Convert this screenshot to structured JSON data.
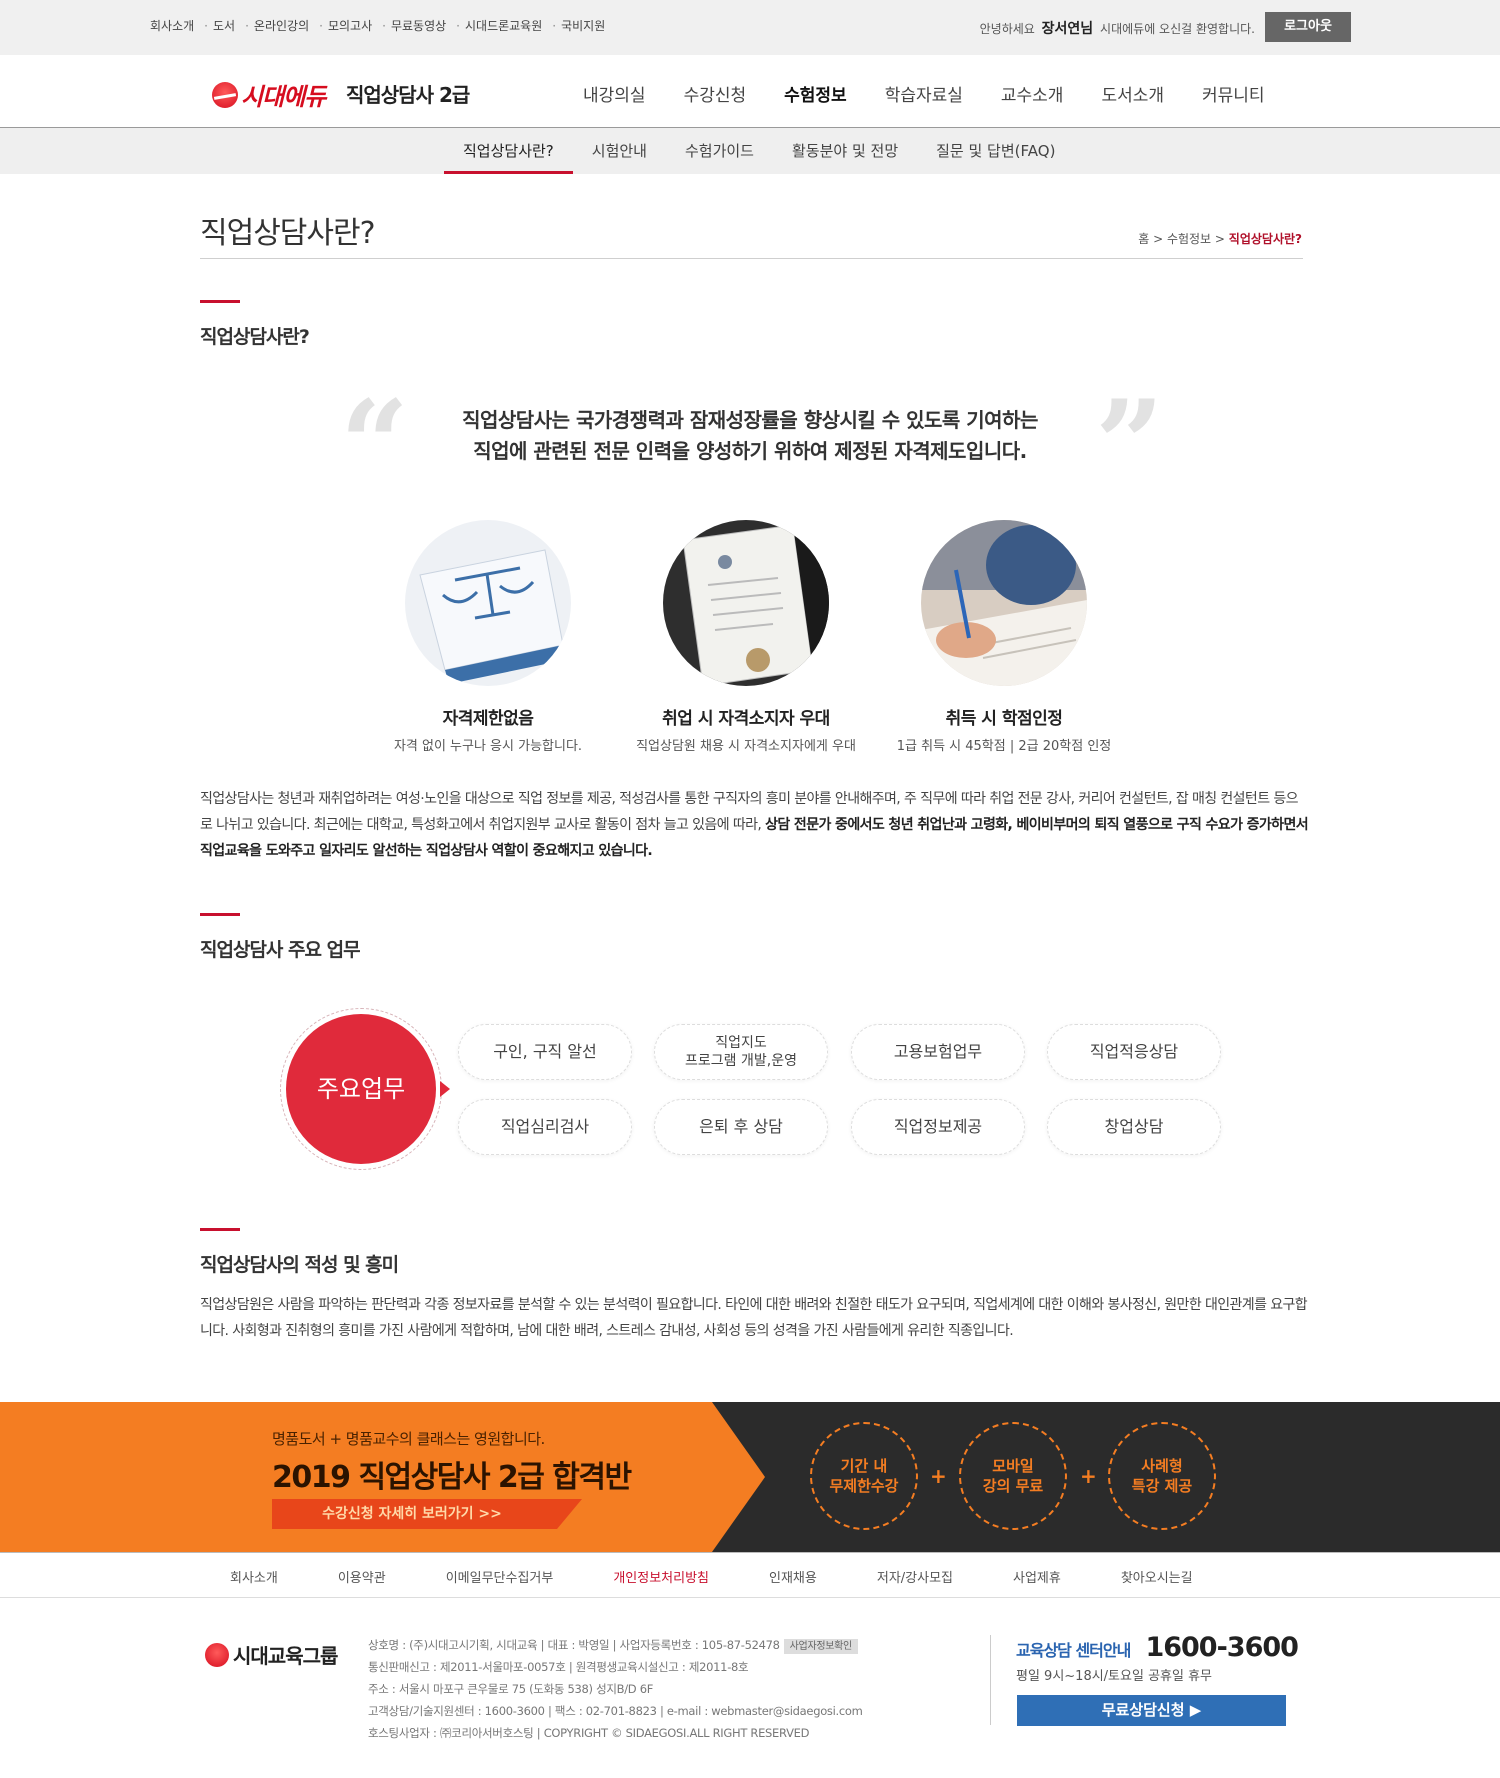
{
  "topbar": {
    "links": [
      "회사소개",
      "도서",
      "온라인강의",
      "모의고사",
      "무료동영상",
      "시대드론교육원",
      "국비지원"
    ],
    "greeting_pre": "안녕하세요",
    "user_name": "장서연님",
    "greeting_post": "시대에듀에 오신걸 환영합니다.",
    "logout_label": "로그아웃"
  },
  "header": {
    "logo_text": "시대에듀",
    "site_title": "직업상담사 2급",
    "gnb": [
      "내강의실",
      "수강신청",
      "수험정보",
      "학습자료실",
      "교수소개",
      "도서소개",
      "커뮤니티"
    ],
    "gnb_active": "수험정보"
  },
  "subnav": {
    "items": [
      "직업상담사란?",
      "시험안내",
      "수험가이드",
      "활동분야 및 전망",
      "질문 및 답변(FAQ)"
    ],
    "active": "직업상담사란?"
  },
  "page": {
    "title": "직업상담사란?",
    "breadcrumb": [
      "홈",
      "수험정보",
      "직업상담사란?"
    ]
  },
  "section1": {
    "title": "직업상담사란?",
    "quote_line1": "직업상담사는 국가경쟁력과 잠재성장률을 향상시킬 수 있도록 기여하는",
    "quote_line2": "직업에 관련된 전문 인력을 양성하기 위하여 제정된 자격제도입니다.",
    "features": [
      {
        "title": "자격제한없음",
        "desc": "자격 없이 누구나 응시 가능합니다."
      },
      {
        "title": "취업 시 자격소지자 우대",
        "desc": "직업상담원 채용 시 자격소지자에게 우대"
      },
      {
        "title": "취득 시 학점인정",
        "desc": "1급 취득 시 45학점 | 2급 20학점 인정"
      }
    ],
    "para_normal": "직업상담사는 청년과 재취업하려는 여성·노인을 대상으로 직업 정보를 제공, 적성검사를 통한 구직자의 흥미 분야를 안내해주며, 주 직무에 따라 취업 전문 강사, 커리어 컨설턴트, 잡 매칭 컨설턴트 등으로 나뉘고 있습니다. 최근에는 대학교, 특성화고에서 취업지원부 교사로 활동이 점차 늘고 있음에 따라, ",
    "para_bold": "상담 전문가 중에서도 청년 취업난과 고령화, 베이비부머의 퇴직 열풍으로 구직 수요가 증가하면서 직업교육을 도와주고 일자리도 알선하는 직업상담사 역할이 중요해지고 있습니다."
  },
  "section2": {
    "title": "직업상담사 주요 업무",
    "center_label": "주요업무",
    "duties": [
      "구인, 구직 알선",
      "직업지도\n프로그램 개발,운영",
      "고용보험업무",
      "직업적응상담",
      "직업심리검사",
      "은퇴 후 상담",
      "직업정보제공",
      "창업상담"
    ]
  },
  "section3": {
    "title": "직업상담사의 적성 및 흥미",
    "para": "직업상담원은 사람을 파악하는 판단력과 각종 정보자료를 분석할 수 있는 분석력이 필요합니다. 타인에 대한 배려와 친절한 태도가 요구되며, 직업세계에 대한 이해와 봉사정신, 원만한 대인관계를 요구합니다. 사회형과 진취형의 흥미를 가진 사람에게 적합하며, 남에 대한 배려, 스트레스 감내성, 사회성 등의 성격을 가진 사람들에게 유리한 직종입니다."
  },
  "banner": {
    "sub": "명품도서 + 명품교수의 클래스는 영원합니다.",
    "main": "2019 직업상담사 2급 합격반",
    "cta": "수강신청 자세히 보러가기 >>",
    "circles": [
      "기간 내\n무제한수강",
      "모바일\n강의 무료",
      "사례형\n특강 제공"
    ],
    "plus": "+"
  },
  "footer_nav": [
    "회사소개",
    "이용약관",
    "이메일무단수집거부",
    "개인정보처리방침",
    "인재채용",
    "저자/강사모집",
    "사업제휴",
    "찾아오시는길"
  ],
  "footer": {
    "logo_text": "시대교육그룹",
    "info": [
      "상호명 : (주)시대고시기획, 시대교육 | 대표 : 박영일 | 사업자등록번호 : 105-87-52478",
      "통신판매신고 : 제2011-서울마포-0057호 | 원격평생교육시설신고 : 제2011-8호",
      "주소 : 서울시 마포구 큰우물로 75 (도화동 538) 성지B/D 6F",
      "고객상담/기술지원센터 : 1600-3600 | 팩스 : 02-701-8823 | e-mail : webmaster@sidaegosi.com",
      "호스팅사업자 : ㈜코리아서버호스팅 | COPYRIGHT © SIDAEGOSI.ALL RIGHT RESERVED"
    ],
    "biz_tag": "사업자정보확인",
    "center_label": "교육상담 센터안내",
    "center_tel": "1600-3600",
    "center_hours": "평일 9시~18시/토요일 공휴일 휴무",
    "consult_button": "무료상담신청 ▶"
  },
  "colors": {
    "accent": "#c8102e",
    "orange": "#f47d22",
    "dark": "#2b2b2b",
    "blue": "#2f6fb6"
  }
}
